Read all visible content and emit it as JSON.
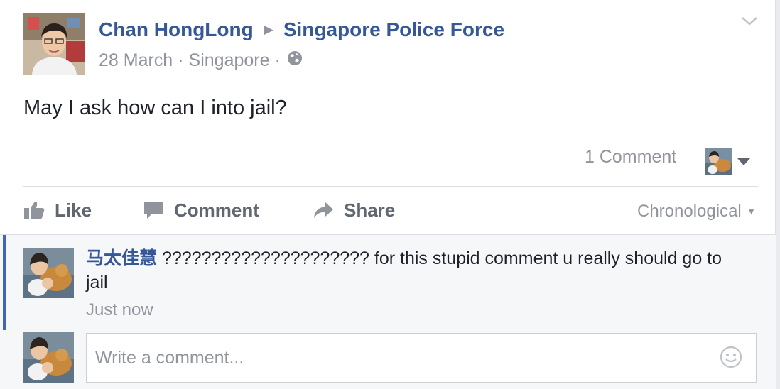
{
  "post": {
    "author": "Chan HongLong",
    "target_page": "Singapore Police Force",
    "date": "28 March",
    "location": "Singapore",
    "separator": "·",
    "privacy_icon": "globe-icon",
    "text": "May I ask how can I into jail?",
    "comment_count": "1 Comment"
  },
  "actions": {
    "like": "Like",
    "comment": "Comment",
    "share": "Share",
    "order": "Chronological"
  },
  "comment": {
    "author": "马太佳慧",
    "text": "????????????????????? for this stupid comment u really should go to jail",
    "time": "Just now"
  },
  "composer": {
    "placeholder": "Write a comment..."
  },
  "colors": {
    "link": "#365899",
    "muted": "#90949c",
    "accent": "#4267b2",
    "action": "#606770"
  }
}
